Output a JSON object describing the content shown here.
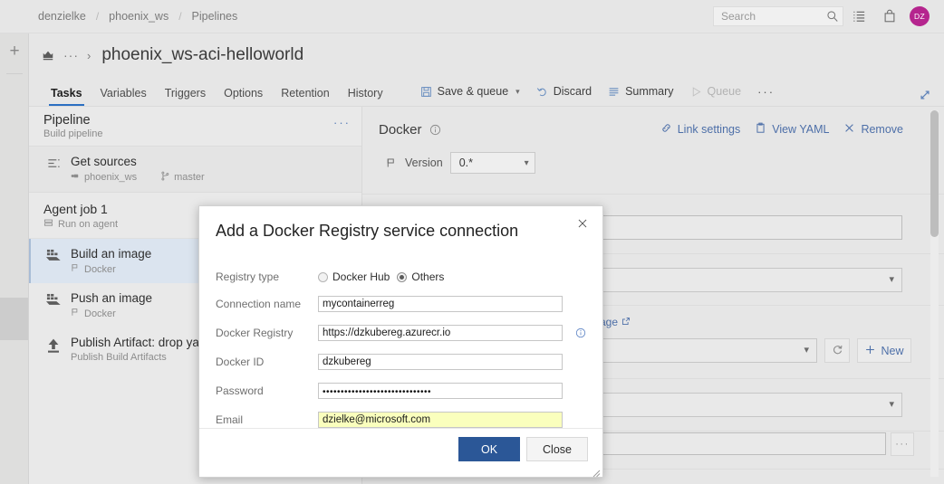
{
  "header": {
    "breadcrumb": [
      "denzielke",
      "phoenix_ws",
      "Pipelines"
    ],
    "separator": "/",
    "search_placeholder": "Search",
    "avatar_initials": "DZ",
    "icons": {
      "search": "search-icon",
      "work_items": "work-items-icon",
      "marketplace": "marketplace-bag-icon"
    }
  },
  "pipeline": {
    "title": "phoenix_ws-aci-helloworld",
    "ellipsis": "···",
    "chevron": "›"
  },
  "tabs": [
    {
      "label": "Tasks",
      "active": true
    },
    {
      "label": "Variables",
      "active": false
    },
    {
      "label": "Triggers",
      "active": false
    },
    {
      "label": "Options",
      "active": false
    },
    {
      "label": "Retention",
      "active": false
    },
    {
      "label": "History",
      "active": false
    }
  ],
  "commands": [
    {
      "label": "Save & queue",
      "icon": "save-icon",
      "has_caret": true,
      "disabled": false
    },
    {
      "label": "Discard",
      "icon": "undo-icon",
      "has_caret": false,
      "disabled": false
    },
    {
      "label": "Summary",
      "icon": "summary-list-icon",
      "has_caret": false,
      "disabled": false
    },
    {
      "label": "Queue",
      "icon": "play-triangle-icon",
      "has_caret": false,
      "disabled": true
    }
  ],
  "commands_more": "···",
  "task_pane": {
    "header": {
      "title": "Pipeline",
      "subtitle": "Build pipeline",
      "menu": "···"
    },
    "get_sources": {
      "title": "Get sources",
      "repo": "phoenix_ws",
      "branch": "master",
      "repo_icon": "git-repo-icon",
      "branch_icon": "branch-icon",
      "icon": "get-sources-icon"
    },
    "job": {
      "title": "Agent job 1",
      "subtitle": "Run on agent",
      "icon": "agent-icon"
    },
    "tasks": [
      {
        "title": "Build an image",
        "subtitle": "Docker",
        "icon": "docker-whale-icon",
        "selected": true
      },
      {
        "title": "Push an image",
        "subtitle": "Docker",
        "icon": "docker-whale-icon",
        "selected": false
      },
      {
        "title": "Publish Artifact: drop ya",
        "subtitle": "Publish Build Artifacts",
        "icon": "publish-upload-icon",
        "selected": false
      }
    ]
  },
  "detail": {
    "title": "Docker",
    "info_icon": "info-circle-icon",
    "actions": [
      {
        "label": "Link settings",
        "icon": "link-settings-icon"
      },
      {
        "label": "View YAML",
        "icon": "yaml-clipboard-icon"
      },
      {
        "label": "Remove",
        "icon": "remove-x-icon"
      }
    ],
    "version_label": "Version",
    "version_value": "0.*",
    "version_icon": "flag-icon",
    "partial_link": "age",
    "external_link_icon": "external-link-icon",
    "refresh_icon": "refresh-icon",
    "new_button": "New",
    "new_icon": "plus-icon",
    "ellipsis_button": "···",
    "expand_icon": "expand-diagonal-icon"
  },
  "dialog": {
    "title": "Add a Docker Registry service connection",
    "close_icon": "close-x-icon",
    "registry_type": {
      "label": "Registry type",
      "options": [
        {
          "label": "Docker Hub",
          "selected": false
        },
        {
          "label": "Others",
          "selected": true
        }
      ]
    },
    "fields": [
      {
        "label": "Connection name",
        "value": "mycontainerreg",
        "type": "text",
        "autofill": false,
        "info": false
      },
      {
        "label": "Docker Registry",
        "value": "https://dzkubereg.azurecr.io",
        "type": "text",
        "autofill": false,
        "info": true
      },
      {
        "label": "Docker ID",
        "value": "dzkubereg",
        "type": "text",
        "autofill": false,
        "info": false
      },
      {
        "label": "Password",
        "value": "••••••••••••••••••••••••••••••",
        "type": "password",
        "autofill": false,
        "info": false
      },
      {
        "label": "Email",
        "value": "dzielke@microsoft.com",
        "type": "text",
        "autofill": true,
        "info": false
      }
    ],
    "buttons": {
      "ok": "OK",
      "close": "Close"
    },
    "info_icon": "info-circle-icon",
    "resize_grip": "resize-grip-icon"
  },
  "colors": {
    "accent_blue": "#2b5797",
    "link_blue": "#4d6fa8",
    "tab_underline": "#2b6fc2",
    "avatar": "#b5258e",
    "autofill_yellow": "#faffbd",
    "selected_task": "#dbe4ef"
  }
}
